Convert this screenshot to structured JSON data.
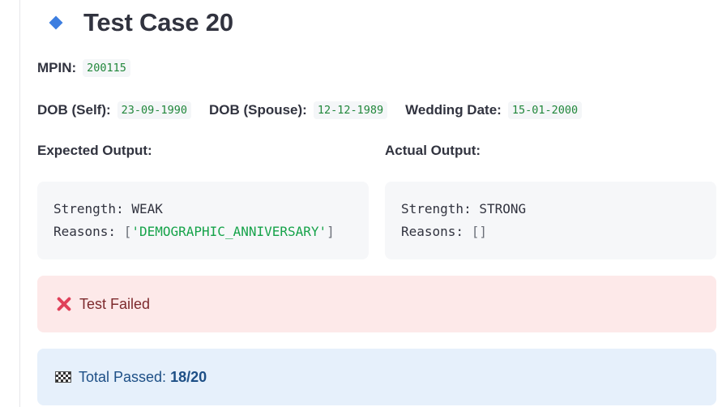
{
  "header": {
    "title": "Test Case 20",
    "icon": "diamond-icon",
    "icon_color": "#3d7ee0"
  },
  "fields": {
    "mpin_label": "MPIN:",
    "mpin_value": "200115",
    "dob_self_label": "DOB (Self):",
    "dob_self_value": "23-09-1990",
    "dob_spouse_label": "DOB (Spouse):",
    "dob_spouse_value": "12-12-1989",
    "wedding_label": "Wedding Date:",
    "wedding_value": "15-01-2000"
  },
  "expected": {
    "heading": "Expected Output:",
    "strength_key": "Strength:",
    "strength_value": "WEAK",
    "reasons_key": "Reasons:",
    "reasons_open": "[",
    "reasons_items": "'DEMOGRAPHIC_ANNIVERSARY'",
    "reasons_close": "]"
  },
  "actual": {
    "heading": "Actual Output:",
    "strength_key": "Strength:",
    "strength_value": "STRONG",
    "reasons_key": "Reasons:",
    "reasons_value": "[]"
  },
  "result": {
    "icon": "cross-mark-icon",
    "text": "Test Failed",
    "color": "#e0415a"
  },
  "summary": {
    "icon": "checkered-flag-icon",
    "label": "Total Passed:",
    "value": "18/20"
  }
}
